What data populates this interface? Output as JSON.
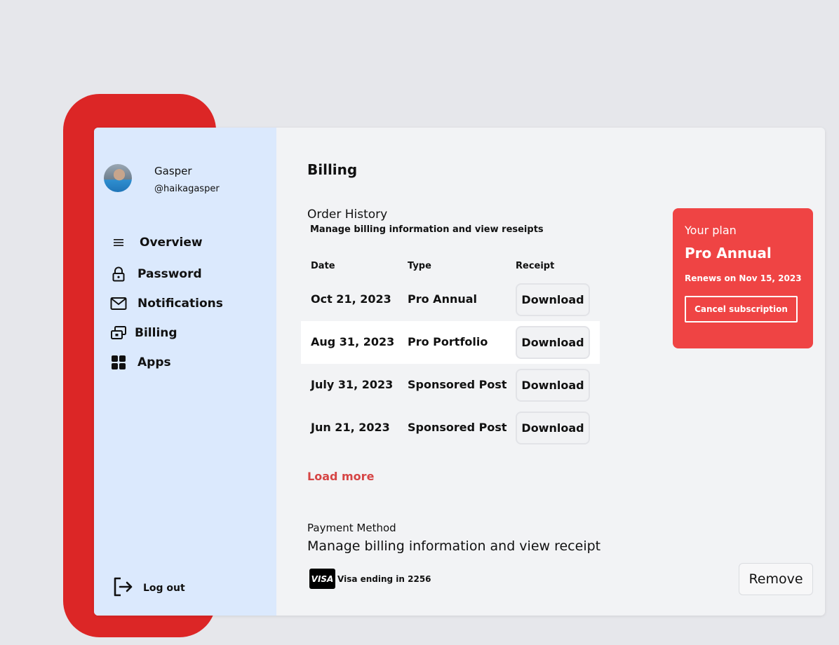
{
  "user": {
    "name": "Gasper",
    "handle": "@haikagasper"
  },
  "sidebar": {
    "items": [
      {
        "label": "Overview",
        "icon": "menu-icon"
      },
      {
        "label": "Password",
        "icon": "lock-icon"
      },
      {
        "label": "Notifications",
        "icon": "mail-icon"
      },
      {
        "label": "Billing",
        "icon": "billing-icon"
      },
      {
        "label": "Apps",
        "icon": "apps-grid-icon"
      }
    ],
    "logout_label": "Log out"
  },
  "main": {
    "title": "Billing",
    "order_history": {
      "title": "Order History",
      "subtitle": "Manage billing information and view reseipts",
      "columns": [
        "Date",
        "Type",
        "Receipt"
      ],
      "rows": [
        {
          "date": "Oct 21, 2023",
          "type": "Pro Annual",
          "action": "Download"
        },
        {
          "date": "Aug 31, 2023",
          "type": "Pro Portfolio",
          "action": "Download"
        },
        {
          "date": "July 31, 2023",
          "type": "Sponsored Post",
          "action": "Download"
        },
        {
          "date": "Jun 21, 2023",
          "type": "Sponsored Post",
          "action": "Download"
        }
      ],
      "load_more": "Load more"
    },
    "payment": {
      "title": "Payment Method",
      "subtitle": "Manage billing information and view receipt",
      "card_brand": "VISA",
      "card_text": "Visa ending in 2256",
      "remove_label": "Remove"
    }
  },
  "plan": {
    "label": "Your plan",
    "name": "Pro Annual",
    "renews": "Renews on Nov 15, 2023",
    "cancel_label": "Cancel subscription"
  },
  "colors": {
    "accent_red": "#dc2626",
    "plan_card": "#ef4444",
    "link_red": "#d64545",
    "sidebar_bg": "#dbe9fd",
    "page_bg": "#e6e7eb"
  }
}
